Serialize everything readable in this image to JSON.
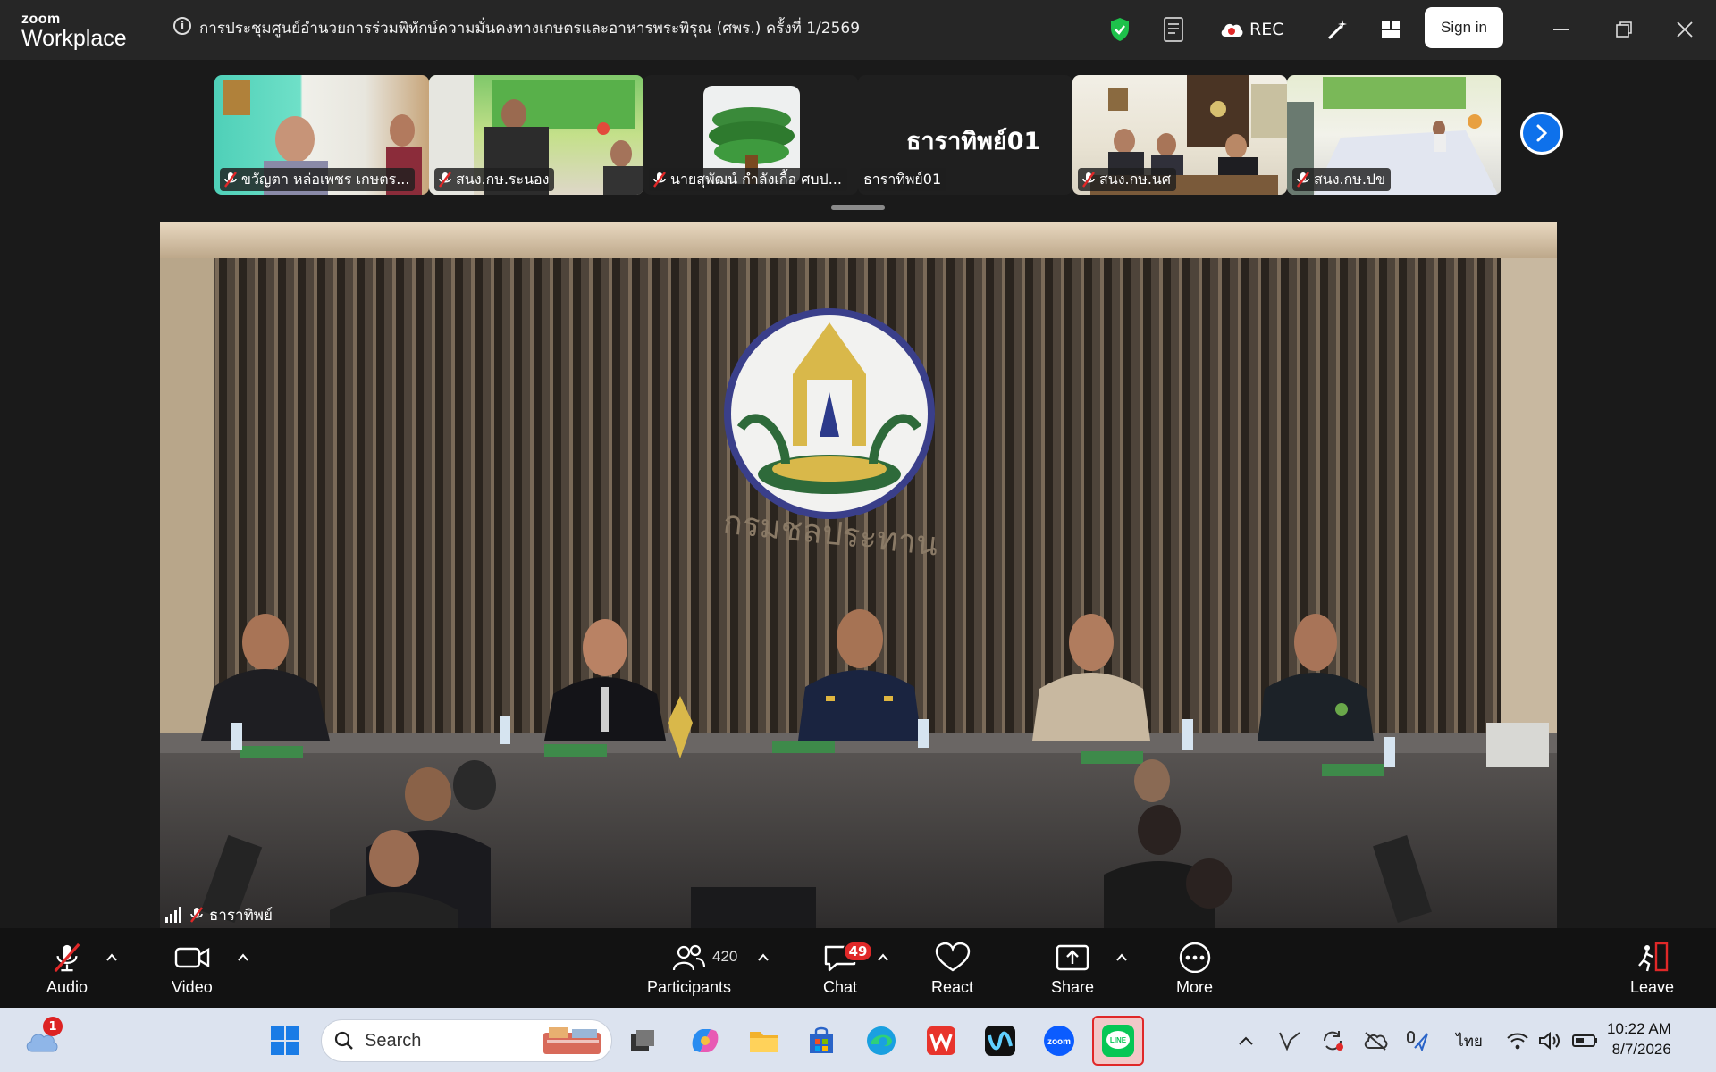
{
  "app": {
    "logo_top": "zoom",
    "logo_bottom": "Workplace"
  },
  "meeting": {
    "title": "การประชุมศูนย์อำนวยการร่วมพิทักษ์ความมั่นคงทางเกษตรและอาหารพระพิรุณ (ศพร.) ครั้งที่ 1/2569"
  },
  "titlebar": {
    "rec_label": "REC",
    "signin_label": "Sign in"
  },
  "participants_strip": [
    {
      "label": "ขวัญตา  หล่อเพชร เกษตร...",
      "muted": true
    },
    {
      "label": "สนง.กษ.ระนอง",
      "muted": true
    },
    {
      "label": "นายสุพัฒน์ กำลังเกื้อ  ศบป...",
      "muted": true
    },
    {
      "label": "ธาราทิพย์01",
      "muted": false,
      "center_name": "ธาราทิพย์01"
    },
    {
      "label": "สนง.กษ.นศ",
      "muted": true
    },
    {
      "label": "สนง.กษ.ปข",
      "muted": true
    }
  ],
  "main_video": {
    "speaker_label": "ธาราทิพย์",
    "wall_text": "กรมชลประทาน"
  },
  "toolbar": {
    "audio": "Audio",
    "video": "Video",
    "participants": "Participants",
    "participants_count": "420",
    "chat": "Chat",
    "chat_badge": "49",
    "react": "React",
    "share": "Share",
    "more": "More",
    "leave": "Leave"
  },
  "taskbar": {
    "search_placeholder": "Search",
    "weather_badge": "1",
    "lang": "ไทย",
    "time": "10:22 AM",
    "date": "8/7/2026"
  },
  "colors": {
    "accent": "#0e71eb",
    "danger": "#e02828",
    "shield": "#1ec14b"
  }
}
